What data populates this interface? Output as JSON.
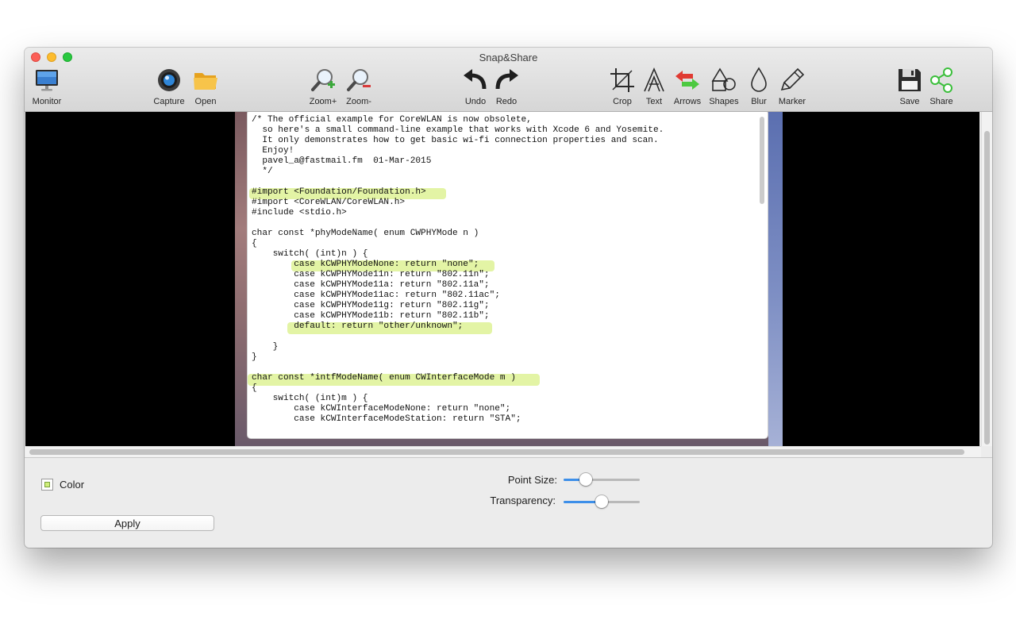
{
  "window": {
    "title": "Snap&Share"
  },
  "toolbar": {
    "monitor": "Monitor",
    "capture": "Capture",
    "open": "Open",
    "zoom_in": "Zoom+",
    "zoom_out": "Zoom-",
    "undo": "Undo",
    "redo": "Redo",
    "crop": "Crop",
    "text": "Text",
    "arrows": "Arrows",
    "shapes": "Shapes",
    "blur": "Blur",
    "marker": "Marker",
    "save": "Save",
    "share": "Share"
  },
  "canvas": {
    "code": "/* The official example for CoreWLAN is now obsolete,\n  so here's a small command-line example that works with Xcode 6 and Yosemite.\n  It only demonstrates how to get basic wi-fi connection properties and scan.\n  Enjoy!\n  pavel_a@fastmail.fm  01-Mar-2015\n  */\n\n#import <Foundation/Foundation.h>\n#import <CoreWLAN/CoreWLAN.h>\n#include <stdio.h>\n\nchar const *phyModeName( enum CWPHYMode n )\n{\n    switch( (int)n ) {\n        case kCWPHYModeNone: return \"none\";\n        case kCWPHYMode11n: return \"802.11n\";\n        case kCWPHYMode11a: return \"802.11a\";\n        case kCWPHYMode11ac: return \"802.11ac\";\n        case kCWPHYMode11g: return \"802.11g\";\n        case kCWPHYMode11b: return \"802.11b\";\n        default: return \"other/unknown\";\n\n    }\n}\n\nchar const *intfModeName( enum CWInterfaceMode m )\n{\n    switch( (int)m ) {\n        case kCWInterfaceModeNone: return \"none\";\n        case kCWInterfaceModeStation: return \"STA\";",
    "highlight_color": "#d2ee6e"
  },
  "panel": {
    "color_label": "Color",
    "color_value": "#cfee7a",
    "apply_label": "Apply",
    "point_size_label": "Point Size:",
    "point_size_value": 0.25,
    "transparency_label": "Transparency:",
    "transparency_value": 0.5
  }
}
